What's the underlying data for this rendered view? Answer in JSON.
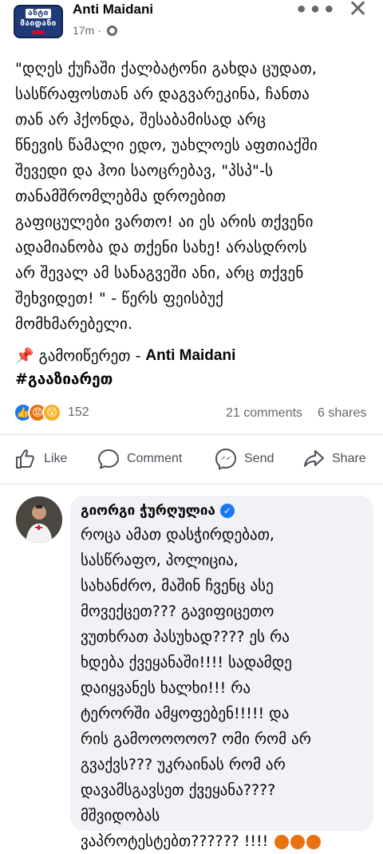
{
  "header": {
    "logo_line1": "ანტი",
    "logo_line2": "მაიდანი",
    "page_name": "Anti Maidani",
    "time": "17m",
    "separator": "·"
  },
  "post": {
    "text": "\"დღეს ქუჩაში ქალბატონი გახდა ცუდათ,\nსასწრაფოსთან არ დაგვარეკინა, ჩანთა\nთან არ ჰქონდა, შესაბამისად არც\nწნევის წამალი ედო, უახლოეს აფთიაქში\nშევედი და ჰოი საოცრებავ, \"პსპ\"-ს\nთანამშრომლებმა დროებით\nგაფიცულები ვართო! აი ეს არის თქვენი\nადამიანობა და თქენი სახე! არასდროს\nარ შევალ ამ სანაგვეში ანი, არც თქვენ\nშეხვიდეთ! \" - წერს ფეისბუქ\nმომხმარებელი.",
    "subscribe_label": "გამოიწერეთ -",
    "subscribe_name": "Anti Maidani",
    "hashtag": "#გააზიარეთ"
  },
  "stats": {
    "reaction_count": "152",
    "comments": "21 comments",
    "shares": "6 shares"
  },
  "actions": {
    "like": "Like",
    "comment": "Comment",
    "send": "Send",
    "share": "Share"
  },
  "comment": {
    "author": "გიორგი ჭურღულია",
    "text": "როცა ამათ დასჭირდებათ,\nსასწრაფო, პოლიცია,\nსახანძრო, მაშინ ჩვენც ასე\nმოვექცეთ??? გავიფიცეთო\nვუთხრათ პასუხად???? ეს რა\nხდება ქვეყანაში!!!! სადამდე\nდაიყვანეს ხალხი!!! რა\nტერორში ამყოფებენ!!!!! და\nრის გამოოოოოო? ომი რომ არ\nგვაქვს??? უკრაინას რომ არ\nდავამსგავსეთ ქვეყანა????\nმშვიდობას\nვაპროტესტებთ?????? !!!!"
  },
  "colors": {
    "accent": "#1877f2",
    "secondary_text": "#65676b",
    "comment_bg": "#f0f2f5"
  }
}
